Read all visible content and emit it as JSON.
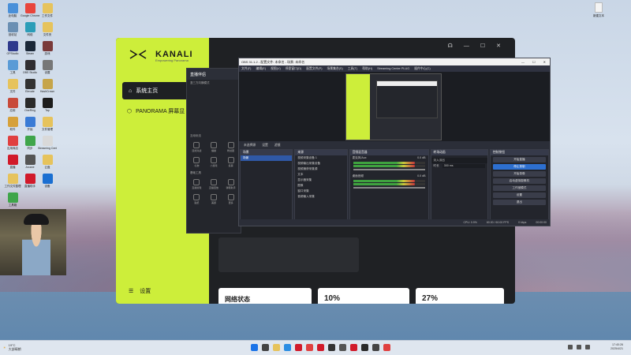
{
  "desktop": {
    "left_icons": [
      {
        "label": "此电脑",
        "color": "#4a90d9"
      },
      {
        "label": "Google Chrome",
        "color": "#e8453c"
      },
      {
        "label": "工作文件",
        "color": "#e6c35c"
      },
      {
        "label": "回收站",
        "color": "#6a8fb3"
      },
      {
        "label": "网络",
        "color": "#2b9db8"
      },
      {
        "label": "文件夹",
        "color": "#e6c35c"
      },
      {
        "label": "OPStudio",
        "color": "#2e3a8c"
      },
      {
        "label": "Steam",
        "color": "#1b2838"
      },
      {
        "label": "游戏",
        "color": "#7a3a3a"
      },
      {
        "label": "工具",
        "color": "#5a9bd6"
      },
      {
        "label": "OBS Studio",
        "color": "#302e31"
      },
      {
        "label": "设置",
        "color": "#777"
      },
      {
        "label": "文件",
        "color": "#e6c35c"
      },
      {
        "label": "Elevate",
        "color": "#333"
      },
      {
        "label": "HashCrown",
        "color": "#c6a54a"
      },
      {
        "label": "应用",
        "color": "#c84a3a"
      },
      {
        "label": "OneRing",
        "color": "#2a2a2a"
      },
      {
        "label": "Tap",
        "color": "#1c1c1c"
      },
      {
        "label": "软件",
        "color": "#d6a13a"
      },
      {
        "label": "开始",
        "color": "#3a7bd5"
      },
      {
        "label": "文件管理",
        "color": "#e6c35c"
      },
      {
        "label": "应用商店",
        "color": "#e04040"
      },
      {
        "label": "同步",
        "color": "#3fa54a"
      },
      {
        "label": "Streaming Center",
        "color": "#d9d9d9"
      },
      {
        "label": "直播",
        "color": "#d11a2a"
      },
      {
        "label": "Arcane",
        "color": "#555"
      },
      {
        "label": "云盘",
        "color": "#e6c35c"
      },
      {
        "label": "工作文件整理",
        "color": "#e6c35c"
      },
      {
        "label": "直播助手",
        "color": "#d11a2a"
      },
      {
        "label": "设备",
        "color": "#1a6fd1"
      },
      {
        "label": "工具箱",
        "color": "#3fa54a"
      }
    ],
    "right_icon": {
      "label": "新建文本"
    }
  },
  "kanali": {
    "logo": "KANALI",
    "logo_sub": "Empowering Panorama",
    "nav_home": "系统主页",
    "nav_panorama": "PANORAMA 屏幕显",
    "settings": "设置",
    "network_status": "网络状态",
    "stat1": "10%",
    "stat2": "27%",
    "accent": "#cdee3a"
  },
  "mini": {
    "title": "直播伴侣",
    "mode": "竖三方向横模式",
    "section_tools": "互动玩法",
    "section_basic": "基础工具",
    "cells_a": [
      "连线对战",
      "福袋",
      "粉丝团"
    ],
    "cells_b": [
      "礼物",
      "小游戏",
      "投票"
    ],
    "cells_c": [
      "直播剪辑",
      "直播回放",
      "弹幕助手"
    ],
    "cells_d": [
      "贴纸",
      "美颜",
      "更多"
    ]
  },
  "obs": {
    "title": "OBS 31.1.2 - 配置文件: 未命名 - 场景: 未命名",
    "menu": [
      "文件(F)",
      "编辑(E)",
      "视图(V)",
      "停靠窗口(D)",
      "配置文件(P)",
      "场景集合(S)",
      "工具(T)",
      "帮助(H)",
      "Streaming Center PLUG",
      "插件中心(C)"
    ],
    "tabs": [
      "未选择源",
      "设置",
      "滤镜"
    ],
    "scenes_header": "场景",
    "scenes": [
      "场景"
    ],
    "sources_header": "来源",
    "sources": [
      "视频采集设备 1",
      "视频输出采集设备",
      "视频捕获采集源",
      "文本",
      "显示器采集",
      "图像",
      "窗口采集",
      "音频输入采集"
    ],
    "mixer_header": "音频混音器",
    "mixer_tracks": [
      "麦克风/Aux",
      "桌面音频"
    ],
    "mixer_values": [
      "0.0 dB",
      "0.0 dB"
    ],
    "transition_header": "转场动画",
    "transition_value": "淡入淡出",
    "duration_label": "时长",
    "duration_value": "300 ms",
    "controls_header": "控制按钮",
    "controls": [
      "开始直播",
      "停止录制",
      "开始录像",
      "启动虚拟摄像机",
      "工作室模式",
      "设置",
      "退出"
    ],
    "status": [
      "CPU: 0.9%",
      "60.00 / 60.00 FPS",
      "0 kbps",
      "00:00:00"
    ]
  },
  "taskbar": {
    "weather_temp": "19°C",
    "weather_desc": "大部晴朗",
    "time": "17:40:26",
    "date": "2025/4/21",
    "app_colors": [
      "#1a73e8",
      "#444",
      "#e6c35c",
      "#2b8de3",
      "#d11a2a",
      "#e04040",
      "#d11a2a",
      "#333",
      "#555",
      "#d11a2a",
      "#2a2a2a",
      "#444",
      "#e04040"
    ]
  }
}
